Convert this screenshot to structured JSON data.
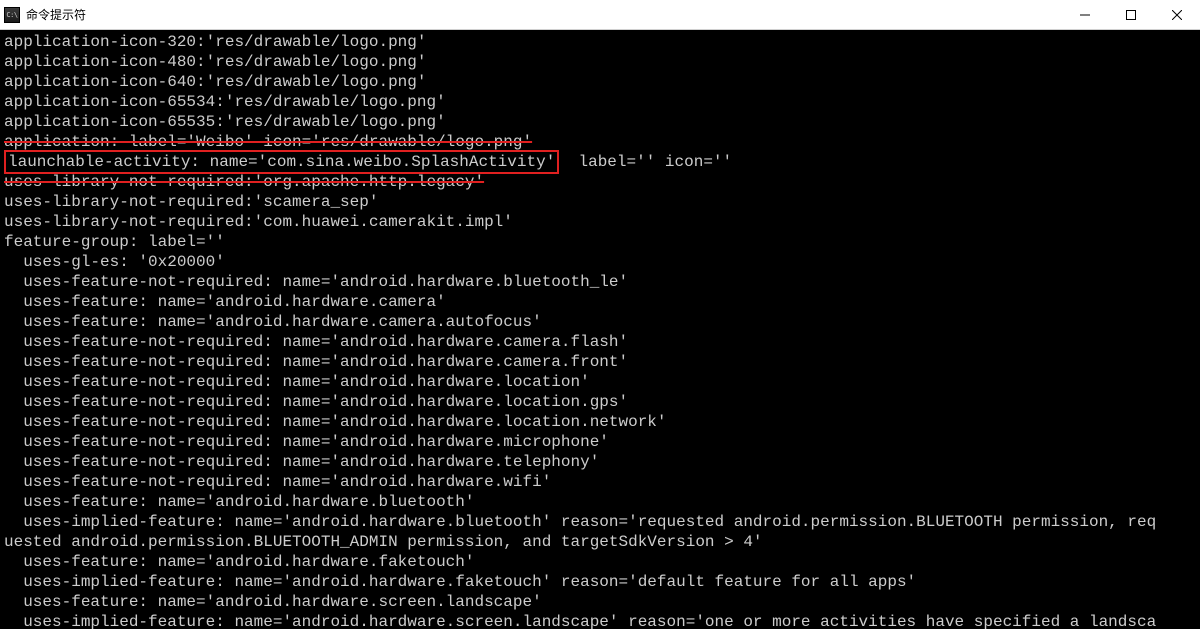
{
  "window": {
    "title": "命令提示符",
    "icon_text": "C:\\"
  },
  "terminal": {
    "lines": [
      "application-icon-320:'res/drawable/logo.png'",
      "application-icon-480:'res/drawable/logo.png'",
      "application-icon-640:'res/drawable/logo.png'",
      "application-icon-65534:'res/drawable/logo.png'",
      "application-icon-65535:'res/drawable/logo.png'"
    ],
    "line_struck": "application: label='Weibo' icon='res/drawable/logo.png'",
    "highlight": {
      "text": "launchable-activity: name='com.sina.weibo.SplashActivity'",
      "rest": "  label='' icon=''"
    },
    "lines_after": [
      "uses-library-not-required:'org.apache.http.legacy'",
      "uses-library-not-required:'scamera_sep'",
      "uses-library-not-required:'com.huawei.camerakit.impl'",
      "feature-group: label=''",
      "  uses-gl-es: '0x20000'",
      "  uses-feature-not-required: name='android.hardware.bluetooth_le'",
      "  uses-feature: name='android.hardware.camera'",
      "  uses-feature: name='android.hardware.camera.autofocus'",
      "  uses-feature-not-required: name='android.hardware.camera.flash'",
      "  uses-feature-not-required: name='android.hardware.camera.front'",
      "  uses-feature-not-required: name='android.hardware.location'",
      "  uses-feature-not-required: name='android.hardware.location.gps'",
      "  uses-feature-not-required: name='android.hardware.location.network'",
      "  uses-feature-not-required: name='android.hardware.microphone'",
      "  uses-feature-not-required: name='android.hardware.telephony'",
      "  uses-feature-not-required: name='android.hardware.wifi'",
      "  uses-feature: name='android.hardware.bluetooth'",
      "  uses-implied-feature: name='android.hardware.bluetooth' reason='requested android.permission.BLUETOOTH permission, req",
      "uested android.permission.BLUETOOTH_ADMIN permission, and targetSdkVersion > 4'",
      "  uses-feature: name='android.hardware.faketouch'",
      "  uses-implied-feature: name='android.hardware.faketouch' reason='default feature for all apps'",
      "  uses-feature: name='android.hardware.screen.landscape'",
      "  uses-implied-feature: name='android.hardware.screen.landscape' reason='one or more activities have specified a landsca"
    ]
  }
}
